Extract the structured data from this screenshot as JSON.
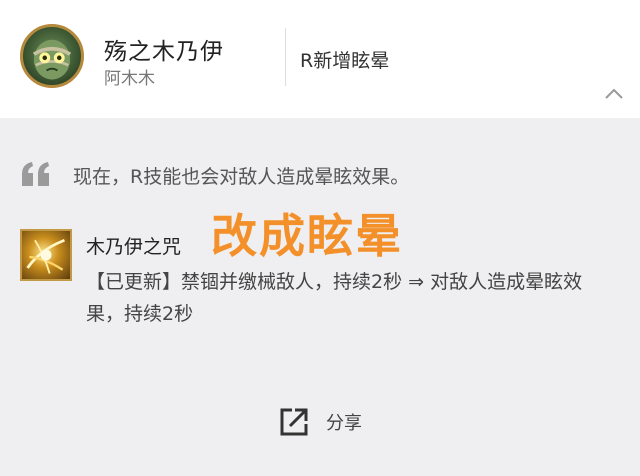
{
  "header": {
    "hero_name": "殇之木乃伊",
    "hero_title": "阿木木",
    "change_title": "R新增眩晕"
  },
  "body": {
    "quote": "现在，R技能也会对敌人造成晕眩效果。",
    "skill_name": "木乃伊之咒",
    "overlay": "改成眩晕",
    "skill_desc": "【已更新】禁锢并缴械敌人，持续2秒 ⇒ 对敌人造成晕眩效果，持续2秒"
  },
  "share": {
    "label": "分享"
  },
  "icons": {
    "avatar": "amumu-portrait",
    "collapse": "chevron-up-icon",
    "quote": "quote-mark-icon",
    "skill": "curse-skill-icon",
    "share": "share-icon"
  },
  "colors": {
    "overlay": "#f3902a",
    "background": "#efeff1",
    "header_bg": "#ffffff"
  }
}
